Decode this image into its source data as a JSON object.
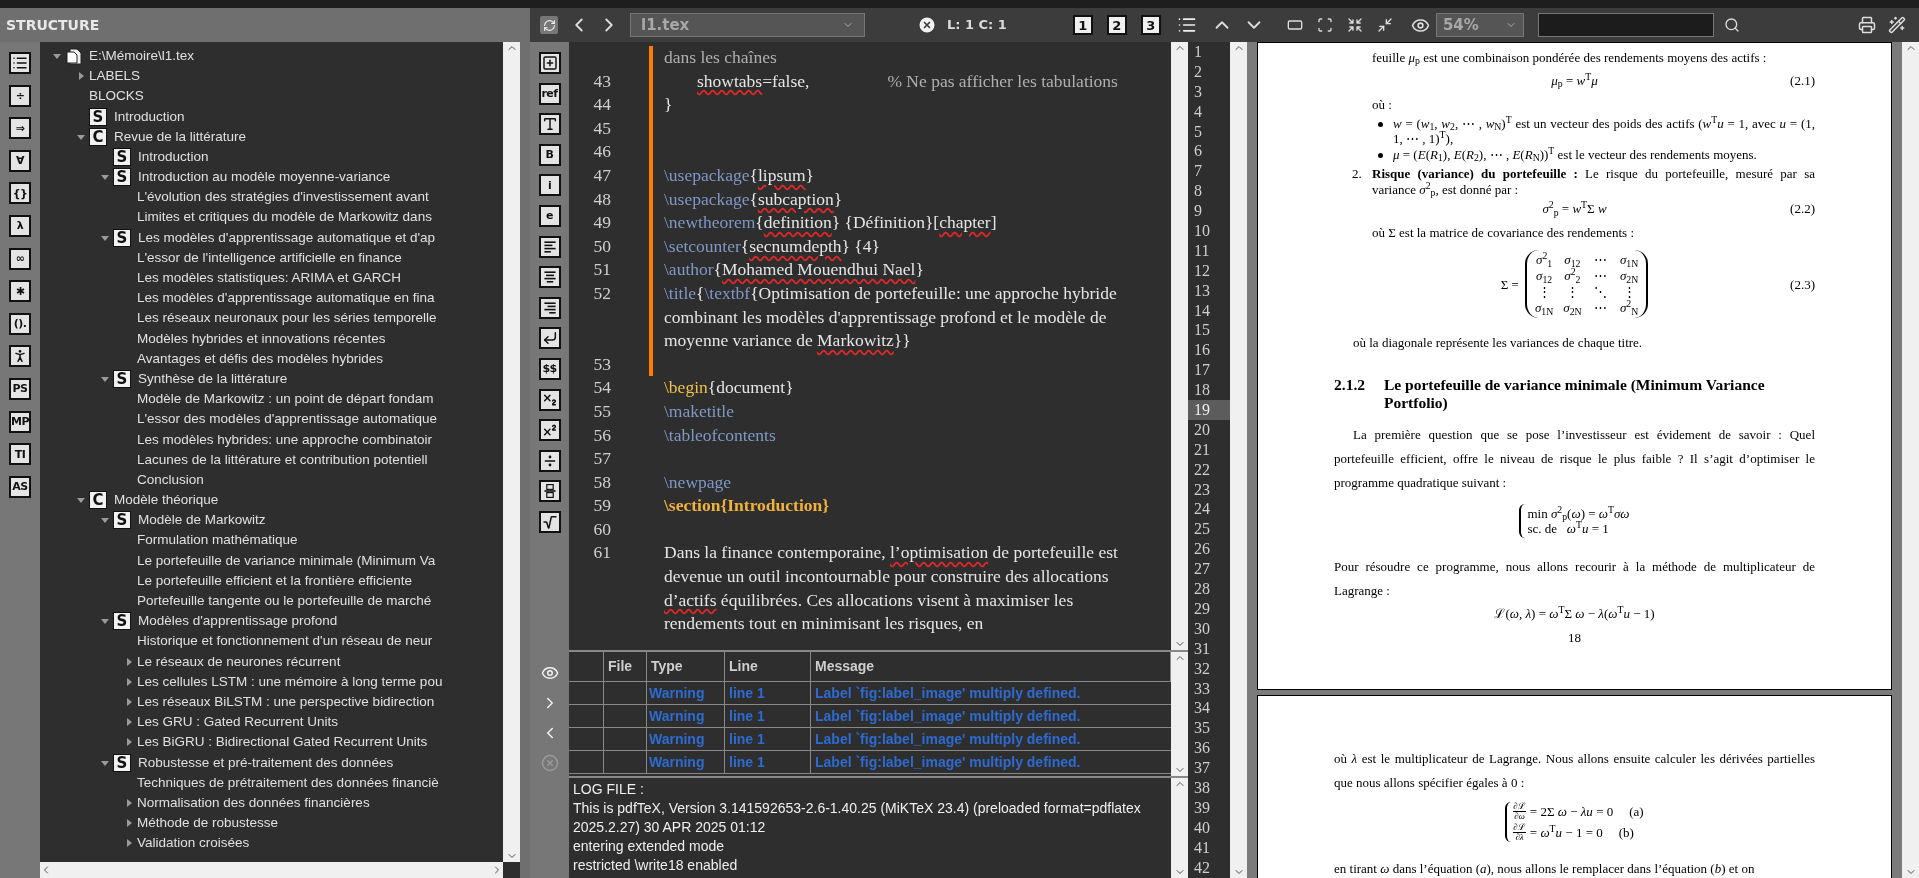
{
  "structure": {
    "title": "STRUCTURE",
    "toolbar": [
      {
        "kind": "list"
      },
      {
        "kind": "glyph",
        "text": "÷"
      },
      {
        "kind": "glyph",
        "text": "⇒"
      },
      {
        "kind": "glyph",
        "text": "∀"
      },
      {
        "kind": "glyph",
        "text": "{}"
      },
      {
        "kind": "glyph",
        "text": "λ"
      },
      {
        "kind": "glyph",
        "text": "∞"
      },
      {
        "kind": "glyph",
        "text": "✱"
      },
      {
        "kind": "glyph",
        "text": "()."
      },
      {
        "kind": "figure"
      },
      {
        "kind": "glyph",
        "text": "PS"
      },
      {
        "kind": "glyph",
        "text": "MP"
      },
      {
        "kind": "glyph",
        "text": "TI"
      },
      {
        "kind": "glyph",
        "text": "AS"
      }
    ],
    "tree": [
      {
        "label": "E:\\Mémoire\\l1.tex",
        "kind": "file",
        "expanded": true,
        "children": [
          {
            "label": "LABELS",
            "expanded": false
          },
          {
            "label": "BLOCKS"
          },
          {
            "label": "Introduction",
            "badge": "S"
          },
          {
            "label": "Revue de la littérature",
            "badge": "C",
            "expanded": true,
            "children": [
              {
                "label": "Introduction",
                "badge": "S"
              },
              {
                "label": "Introduction au modèle moyenne-variance",
                "badge": "S",
                "expanded": true,
                "children": [
                  {
                    "label": "L'évolution des stratégies d'investissement avant"
                  },
                  {
                    "label": "Limites et critiques du modèle de Markowitz dans"
                  }
                ]
              },
              {
                "label": "Les modèles d'apprentissage automatique et d'ap",
                "badge": "S",
                "expanded": true,
                "children": [
                  {
                    "label": "L'essor de l'intelligence artificielle en finance"
                  },
                  {
                    "label": "Les modèles statistiques: ARIMA et GARCH"
                  },
                  {
                    "label": "Les modèles d'apprentissage automatique en fina"
                  },
                  {
                    "label": "Les réseaux neuronaux pour les séries temporelle"
                  },
                  {
                    "label": "Modèles hybrides et innovations récentes"
                  },
                  {
                    "label": "Avantages et défis des modèles hybrides"
                  }
                ]
              },
              {
                "label": "Synthèse de la littérature",
                "badge": "S",
                "expanded": true,
                "children": [
                  {
                    "label": "Modèle de Markowitz : un point de départ fondam"
                  },
                  {
                    "label": "L'essor des modèles d'apprentissage automatique"
                  },
                  {
                    "label": "Les modèles hybrides: une approche combinatoir"
                  },
                  {
                    "label": "Lacunes de la littérature et contribution potentiell"
                  },
                  {
                    "label": "Conclusion"
                  }
                ]
              }
            ]
          },
          {
            "label": "Modèle théorique",
            "badge": "C",
            "expanded": true,
            "children": [
              {
                "label": "Modèle de Markowitz",
                "badge": "S",
                "expanded": true,
                "children": [
                  {
                    "label": "Formulation mathématique"
                  },
                  {
                    "label": "Le portefeuille de variance minimale (Minimum Va"
                  },
                  {
                    "label": "Le portefeuille efficient et la frontière efficiente"
                  },
                  {
                    "label": "Portefeuille tangente ou le portefeuille de marché"
                  }
                ]
              },
              {
                "label": "Modèles d'apprentissage profond",
                "badge": "S",
                "expanded": true,
                "children": [
                  {
                    "label": "Historique et fonctionnement d'un réseau de neur"
                  },
                  {
                    "label": "Le réseaux de neurones récurrent",
                    "expanded": false
                  },
                  {
                    "label": "Les cellules LSTM : une mémoire à long terme pou",
                    "expanded": false
                  },
                  {
                    "label": "Les réseaux BiLSTM : une perspective bidirection",
                    "expanded": false
                  },
                  {
                    "label": "Les GRU : Gated Recurrent Units",
                    "expanded": false
                  },
                  {
                    "label": "Les BiGRU : Bidirectional Gated Recurrent Units",
                    "expanded": false
                  }
                ]
              },
              {
                "label": "Robustesse et pré-traitement des données",
                "badge": "S",
                "expanded": true,
                "children": [
                  {
                    "label": "Techniques de prétraitement des données financiè"
                  },
                  {
                    "label": "Normalisation des données financières",
                    "expanded": false
                  },
                  {
                    "label": "Méthode de robustesse",
                    "expanded": false
                  },
                  {
                    "label": "Validation croisées",
                    "expanded": false
                  }
                ]
              }
            ]
          }
        ]
      }
    ]
  },
  "toolbar": {
    "file": "l1.tex",
    "position": "L: 1 C: 1",
    "view_buttons": [
      "1",
      "2",
      "3"
    ],
    "zoom": "54%"
  },
  "editor": {
    "toolbar": [
      {
        "kind": "insert"
      },
      {
        "kind": "glyph",
        "text": "ref"
      },
      {
        "kind": "font-size"
      },
      {
        "kind": "glyph",
        "text": "B"
      },
      {
        "kind": "glyph",
        "text": "i"
      },
      {
        "kind": "glyph",
        "text": "e"
      },
      {
        "kind": "align-left"
      },
      {
        "kind": "align-center"
      },
      {
        "kind": "align-right"
      },
      {
        "kind": "return"
      },
      {
        "kind": "glyph",
        "text": "$$"
      },
      {
        "kind": "subscript"
      },
      {
        "kind": "superscript"
      },
      {
        "kind": "divide"
      },
      {
        "kind": "fraction"
      },
      {
        "kind": "sqrt"
      }
    ],
    "lines": [
      {
        "modified": true,
        "segments": [
          {
            "kind": "comment",
            "text": "dans les chaînes"
          }
        ]
      },
      {
        "number": "43",
        "modified": true,
        "indent": true,
        "segments": [
          {
            "kind": "misspelled",
            "text": "showtabs"
          },
          {
            "kind": "plain",
            "text": "=false,"
          },
          {
            "kind": "comment",
            "text": "% Ne pas afficher les tabulations"
          }
        ]
      },
      {
        "number": "44",
        "modified": true,
        "segments": [
          {
            "kind": "plain",
            "text": "}"
          }
        ]
      },
      {
        "number": "45",
        "modified": true
      },
      {
        "number": "46",
        "modified": true
      },
      {
        "number": "47",
        "modified": true,
        "segments": [
          {
            "kind": "command",
            "text": "\\usepackage"
          },
          {
            "kind": "plain",
            "text": "{"
          },
          {
            "kind": "misspelled",
            "text": "lipsum"
          },
          {
            "kind": "plain",
            "text": "}"
          }
        ]
      },
      {
        "number": "48",
        "modified": true,
        "segments": [
          {
            "kind": "command",
            "text": "\\usepackage"
          },
          {
            "kind": "plain",
            "text": "{"
          },
          {
            "kind": "misspelled",
            "text": "subcaption"
          },
          {
            "kind": "plain",
            "text": "}"
          }
        ]
      },
      {
        "number": "49",
        "modified": true,
        "segments": [
          {
            "kind": "command",
            "text": "\\newtheorem"
          },
          {
            "kind": "plain",
            "text": "{"
          },
          {
            "kind": "misspelled",
            "text": "definition"
          },
          {
            "kind": "plain",
            "text": "} {Définition}["
          },
          {
            "kind": "misspelled",
            "text": "chapter"
          },
          {
            "kind": "plain",
            "text": "]"
          }
        ]
      },
      {
        "number": "50",
        "modified": true,
        "segments": [
          {
            "kind": "command",
            "text": "\\setcounter"
          },
          {
            "kind": "plain",
            "text": "{"
          },
          {
            "kind": "misspelled",
            "text": "secnumdepth"
          },
          {
            "kind": "plain",
            "text": "} {4}"
          }
        ]
      },
      {
        "number": "51",
        "modified": true,
        "segments": [
          {
            "kind": "command",
            "text": "\\author"
          },
          {
            "kind": "plain",
            "text": "{"
          },
          {
            "kind": "misspelled",
            "text": "Mohamed Mouendhui Nael"
          },
          {
            "kind": "plain",
            "text": "}"
          }
        ]
      },
      {
        "number": "52",
        "modified": true,
        "segments": [
          {
            "kind": "command",
            "text": "\\title"
          },
          {
            "kind": "plain",
            "text": "{"
          },
          {
            "kind": "command",
            "text": "\\textbf"
          },
          {
            "kind": "plain",
            "text": "{Optimisation de portefeuille: une approche hybride combinant les modèles d'apprentissage profond et le modèle de moyenne variance de "
          },
          {
            "kind": "misspelled",
            "text": "Markowitz"
          },
          {
            "kind": "plain",
            "text": "}}"
          }
        ]
      },
      {
        "number": "53",
        "modified": true
      },
      {
        "number": "54",
        "modified": false,
        "segments": [
          {
            "kind": "keyword",
            "text": "\\begin"
          },
          {
            "kind": "plain",
            "text": "{document}"
          }
        ]
      },
      {
        "number": "55",
        "modified": false,
        "segments": [
          {
            "kind": "command",
            "text": "\\maketitle"
          }
        ]
      },
      {
        "number": "56",
        "modified": false,
        "segments": [
          {
            "kind": "command",
            "text": "\\tableofcontents"
          }
        ]
      },
      {
        "number": "57",
        "modified": false
      },
      {
        "number": "58",
        "modified": false,
        "segments": [
          {
            "kind": "command",
            "text": "\\newpage"
          }
        ]
      },
      {
        "number": "59",
        "modified": false,
        "segments": [
          {
            "kind": "heading",
            "text": "\\section{Introduction}"
          }
        ]
      },
      {
        "number": "60",
        "modified": false
      },
      {
        "number": "61",
        "modified": false,
        "segments": [
          {
            "kind": "plain",
            "text": "Dans la finance contemporaine, "
          },
          {
            "kind": "misspelled",
            "text": "l’optimisation"
          },
          {
            "kind": "plain",
            "text": " de portefeuille est devenue un outil incontournable pour construire des allocations "
          },
          {
            "kind": "misspelled",
            "text": "d’actifs"
          },
          {
            "kind": "plain",
            "text": " équilibrées. Ces allocations visent à maximiser les rendements tout en minimisant les risques, en"
          }
        ]
      }
    ]
  },
  "log_toolbar": [
    {
      "kind": "eye",
      "disabled": false
    },
    {
      "kind": "next",
      "disabled": false
    },
    {
      "kind": "previous",
      "disabled": false
    },
    {
      "kind": "clear",
      "disabled": true
    }
  ],
  "messages": {
    "columns": [
      "File",
      "Type",
      "Line",
      "Message"
    ],
    "rows": [
      {
        "type": "Warning",
        "line": "line 1",
        "message": "Label `fig:label_image' multiply defined."
      },
      {
        "type": "Warning",
        "line": "line 1",
        "message": "Label `fig:label_image' multiply defined."
      },
      {
        "type": "Warning",
        "line": "line 1",
        "message": "Label `fig:label_image' multiply defined."
      },
      {
        "type": "Warning",
        "line": "line 1",
        "message": "Label `fig:label_image' multiply defined."
      }
    ]
  },
  "log": {
    "title": "LOG FILE :",
    "lines": [
      "This is pdfTeX, Version 3.141592653-2.6-1.40.25 (MiKTeX 23.4) (preloaded format=pdflatex 2025.2.27) 30 APR 2025 01:12",
      "entering extended mode",
      "restricted \\write18 enabled"
    ]
  },
  "line_strip": [
    {
      "number": "1",
      "selected": false
    },
    {
      "number": "2",
      "selected": false
    },
    {
      "number": "3",
      "selected": false
    },
    {
      "number": "4",
      "selected": false
    },
    {
      "number": "5",
      "selected": false
    },
    {
      "number": "6",
      "selected": false
    },
    {
      "number": "7",
      "selected": false
    },
    {
      "number": "8",
      "selected": false
    },
    {
      "number": "9",
      "selected": false
    },
    {
      "number": "10",
      "selected": false
    },
    {
      "number": "11",
      "selected": false
    },
    {
      "number": "12",
      "selected": false
    },
    {
      "number": "13",
      "selected": false
    },
    {
      "number": "14",
      "selected": false
    },
    {
      "number": "15",
      "selected": false
    },
    {
      "number": "16",
      "selected": false
    },
    {
      "number": "17",
      "selected": false
    },
    {
      "number": "18",
      "selected": false
    },
    {
      "number": "19",
      "selected": true
    },
    {
      "number": "20",
      "selected": false
    },
    {
      "number": "21",
      "selected": false
    },
    {
      "number": "22",
      "selected": false
    },
    {
      "number": "23",
      "selected": false
    },
    {
      "number": "24",
      "selected": false
    },
    {
      "number": "25",
      "selected": false
    },
    {
      "number": "26",
      "selected": false
    },
    {
      "number": "27",
      "selected": false
    },
    {
      "number": "28",
      "selected": false
    },
    {
      "number": "29",
      "selected": false
    },
    {
      "number": "30",
      "selected": false
    },
    {
      "number": "31",
      "selected": false
    },
    {
      "number": "32",
      "selected": false
    },
    {
      "number": "33",
      "selected": false
    },
    {
      "number": "34",
      "selected": false
    },
    {
      "number": "35",
      "selected": false
    },
    {
      "number": "36",
      "selected": false
    },
    {
      "number": "37",
      "selected": false
    },
    {
      "number": "38",
      "selected": false
    },
    {
      "number": "39",
      "selected": false
    },
    {
      "number": "40",
      "selected": false
    },
    {
      "number": "41",
      "selected": false
    },
    {
      "number": "42",
      "selected": false
    }
  ],
  "pdf": {
    "pages": [
      {
        "blocks": [
          {
            "kind": "item_text",
            "text": "feuille *μ*$_{p}$ est une combinaison pondérée des rendements moyens des actifs :"
          },
          {
            "kind": "equation",
            "math": "*μ*$_{p}$ = *w*$^{T}$*μ*",
            "tag": "(2.1)"
          },
          {
            "kind": "item_text",
            "text": "où :"
          },
          {
            "kind": "bullet",
            "text": "*w* = (*w*$_{1}$, *w*$_{2}$, ⋯ , *w*$_{N}$)$^{T}$ est un vecteur des poids des actifs (*w*$^{T}$*u* = 1, avec *u* = (1, 1, ⋯ , 1)$^{T}$),"
          },
          {
            "kind": "bullet",
            "text": "*μ* = (*E*(*R*$_{1}$), *E*(*R*$_{2}$), ⋯ , *E*(*R*$_{N}$))$^{T}$ est le vecteur des rendements moyens."
          },
          {
            "kind": "numbered",
            "marker": "2.",
            "text": "**Risque (variance) du portefeuille :** Le risque du portefeuille, mesuré par sa variance *σ*$^{2}$$_{p}$, est donné par :"
          },
          {
            "kind": "equation",
            "math": "*σ*$^{2}$$_{p}$ = *w*$^{T}$Σ *w*",
            "tag": "(2.2)"
          },
          {
            "kind": "item_text",
            "text": "où Σ est la matrice de covariance des rendements :"
          },
          {
            "kind": "matrix",
            "lhs": "Σ =",
            "tag": "(2.3)",
            "rows": [
              [
                "*σ*$^{2}$$_{1}$",
                "*σ*$_{12}$",
                "⋯",
                "*σ*$_{1N}$"
              ],
              [
                "*σ*$_{12}$",
                "*σ*$^{2}$$_{2}$",
                "⋯",
                "*σ*$_{2N}$"
              ],
              [
                "⋮",
                "⋮",
                "⋱",
                "⋮"
              ],
              [
                "*σ*$_{1N}$",
                "*σ*$_{2N}$",
                "⋯",
                "*σ*$^{2}$$_{N}$"
              ]
            ]
          },
          {
            "kind": "paragraph_indent",
            "text": "où la diagonale représente les variances de chaque titre."
          },
          {
            "kind": "heading",
            "number": "2.1.2",
            "text": "Le portefeuille de variance minimale (Minimum Variance Portfolio)"
          },
          {
            "kind": "paragraph_indent",
            "text": "La première question que se pose l’investisseur est évidement de savoir : Quel portefeuille efficient, offre le niveau de risque le plus faible ? Il s’agit d’optimiser le programme quadratique suivant :"
          },
          {
            "kind": "cases",
            "lines": [
              "min *σ*$^{2}$$_{p}$(*ω*) = *ω*$^{T}$*σω*",
              "sc. de   *ω*$^{T}$*u* = 1"
            ]
          },
          {
            "kind": "paragraph",
            "text": "Pour résoudre ce programme, nous allons recourir à la méthode de multiplicateur de Lagrange :"
          },
          {
            "kind": "equation",
            "math": "ℒ(*ω*, *λ*) = *ω*$^{T}$Σ *ω* − *λ*(*ω*$^{T}$*u* − 1)"
          },
          {
            "kind": "page_number",
            "text": "18"
          }
        ]
      },
      {
        "blocks": [
          {
            "kind": "paragraph",
            "text": "où *λ* est le multiplicateur de Lagrange. Nous allons ensuite calculer les dérivées partielles que nous allons spécifier égales à 0 :"
          },
          {
            "kind": "cases_frac",
            "lines": [
              {
                "num": "∂ℒ",
                "den": "∂*ω*",
                "rhs": "= 2Σ *ω* − *λu* = 0",
                "tag": "(a)"
              },
              {
                "num": "∂ℒ",
                "den": "∂*λ*",
                "rhs": "= *ω*$^{T}$*u* − 1 = 0",
                "tag": "(b)"
              }
            ]
          },
          {
            "kind": "paragraph",
            "text": "en tirant *ω* dans l’équation (*a*), nous allons le remplacer dans l’équation (*b*) et on"
          }
        ]
      }
    ]
  }
}
